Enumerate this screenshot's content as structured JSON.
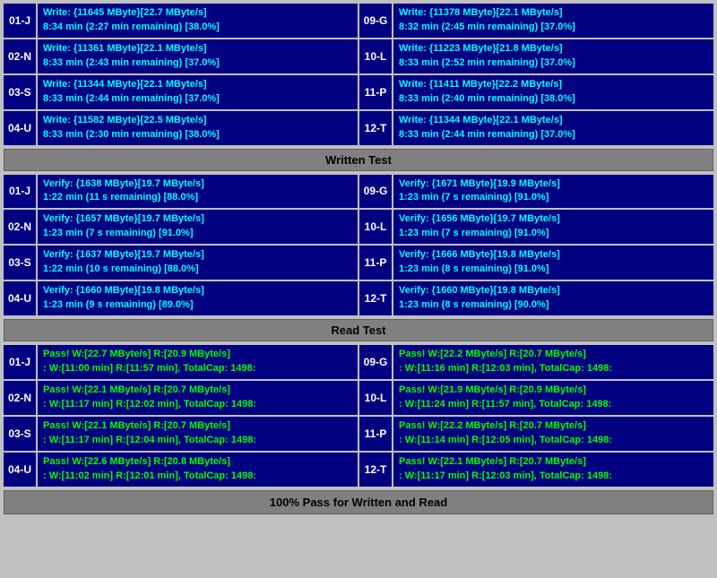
{
  "sections": {
    "write_section": {
      "rows": [
        {
          "id": "01-J",
          "left": {
            "line1": "Write: {11645 MByte}[22.7 MByte/s]",
            "line2": "8:34 min (2:27 min remaining)  [38.0%]"
          },
          "right_id": "09-G",
          "right": {
            "line1": "Write: {11378 MByte}[22.1 MByte/s]",
            "line2": "8:32 min (2:45 min remaining)  [37.0%]"
          }
        },
        {
          "id": "02-N",
          "left": {
            "line1": "Write: {11361 MByte}[22.1 MByte/s]",
            "line2": "8:33 min (2:43 min remaining)  [37.0%]"
          },
          "right_id": "10-L",
          "right": {
            "line1": "Write: {11223 MByte}[21.8 MByte/s]",
            "line2": "8:33 min (2:52 min remaining)  [37.0%]"
          }
        },
        {
          "id": "03-S",
          "left": {
            "line1": "Write: {11344 MByte}[22.1 MByte/s]",
            "line2": "8:33 min (2:44 min remaining)  [37.0%]"
          },
          "right_id": "11-P",
          "right": {
            "line1": "Write: {11411 MByte}[22.2 MByte/s]",
            "line2": "8:33 min (2:40 min remaining)  [38.0%]"
          }
        },
        {
          "id": "04-U",
          "left": {
            "line1": "Write: {11582 MByte}[22.5 MByte/s]",
            "line2": "8:33 min (2:30 min remaining)  [38.0%]"
          },
          "right_id": "12-T",
          "right": {
            "line1": "Write: {11344 MByte}[22.1 MByte/s]",
            "line2": "8:33 min (2:44 min remaining)  [37.0%]"
          }
        }
      ]
    },
    "written_header": "Written Test",
    "verify_section": {
      "rows": [
        {
          "id": "01-J",
          "left": {
            "line1": "Verify: {1638 MByte}[19.7 MByte/s]",
            "line2": "1:22 min (11 s remaining)  [88.0%]"
          },
          "right_id": "09-G",
          "right": {
            "line1": "Verify: {1671 MByte}[19.9 MByte/s]",
            "line2": "1:23 min (7 s remaining)  [91.0%]"
          }
        },
        {
          "id": "02-N",
          "left": {
            "line1": "Verify: {1657 MByte}[19.7 MByte/s]",
            "line2": "1:23 min (7 s remaining)  [91.0%]"
          },
          "right_id": "10-L",
          "right": {
            "line1": "Verify: {1656 MByte}[19.7 MByte/s]",
            "line2": "1:23 min (7 s remaining)  [91.0%]"
          }
        },
        {
          "id": "03-S",
          "left": {
            "line1": "Verify: {1637 MByte}[19.7 MByte/s]",
            "line2": "1:22 min (10 s remaining)  [88.0%]"
          },
          "right_id": "11-P",
          "right": {
            "line1": "Verify: {1666 MByte}[19.8 MByte/s]",
            "line2": "1:23 min (8 s remaining)  [91.0%]"
          }
        },
        {
          "id": "04-U",
          "left": {
            "line1": "Verify: {1660 MByte}[19.8 MByte/s]",
            "line2": "1:23 min (9 s remaining)  [89.0%]"
          },
          "right_id": "12-T",
          "right": {
            "line1": "Verify: {1660 MByte}[19.8 MByte/s]",
            "line2": "1:23 min (8 s remaining)  [90.0%]"
          }
        }
      ]
    },
    "read_header": "Read Test",
    "pass_section": {
      "rows": [
        {
          "id": "01-J",
          "left": {
            "line1": "Pass! W:[22.7 MByte/s] R:[20.9 MByte/s]",
            "line2": ": W:[11:00 min] R:[11:57 min], TotalCap: 1498:"
          },
          "right_id": "09-G",
          "right": {
            "line1": "Pass! W:[22.2 MByte/s] R:[20.7 MByte/s]",
            "line2": ": W:[11:16 min] R:[12:03 min], TotalCap: 1498:"
          }
        },
        {
          "id": "02-N",
          "left": {
            "line1": "Pass! W:[22.1 MByte/s] R:[20.7 MByte/s]",
            "line2": ": W:[11:17 min] R:[12:02 min], TotalCap: 1498:"
          },
          "right_id": "10-L",
          "right": {
            "line1": "Pass! W:[21.9 MByte/s] R:[20.9 MByte/s]",
            "line2": ": W:[11:24 min] R:[11:57 min], TotalCap: 1498:"
          }
        },
        {
          "id": "03-S",
          "left": {
            "line1": "Pass! W:[22.1 MByte/s] R:[20.7 MByte/s]",
            "line2": ": W:[11:17 min] R:[12:04 min], TotalCap: 1498:"
          },
          "right_id": "11-P",
          "right": {
            "line1": "Pass! W:[22.2 MByte/s] R:[20.7 MByte/s]",
            "line2": ": W:[11:14 min] R:[12:05 min], TotalCap: 1498:"
          }
        },
        {
          "id": "04-U",
          "left": {
            "line1": "Pass! W:[22.6 MByte/s] R:[20.8 MByte/s]",
            "line2": ": W:[11:02 min] R:[12:01 min], TotalCap: 1498:"
          },
          "right_id": "12-T",
          "right": {
            "line1": "Pass! W:[22.1 MByte/s] R:[20.7 MByte/s]",
            "line2": ": W:[11:17 min] R:[12:03 min], TotalCap: 1498:"
          }
        }
      ]
    },
    "footer": "100% Pass for Written and Read"
  }
}
